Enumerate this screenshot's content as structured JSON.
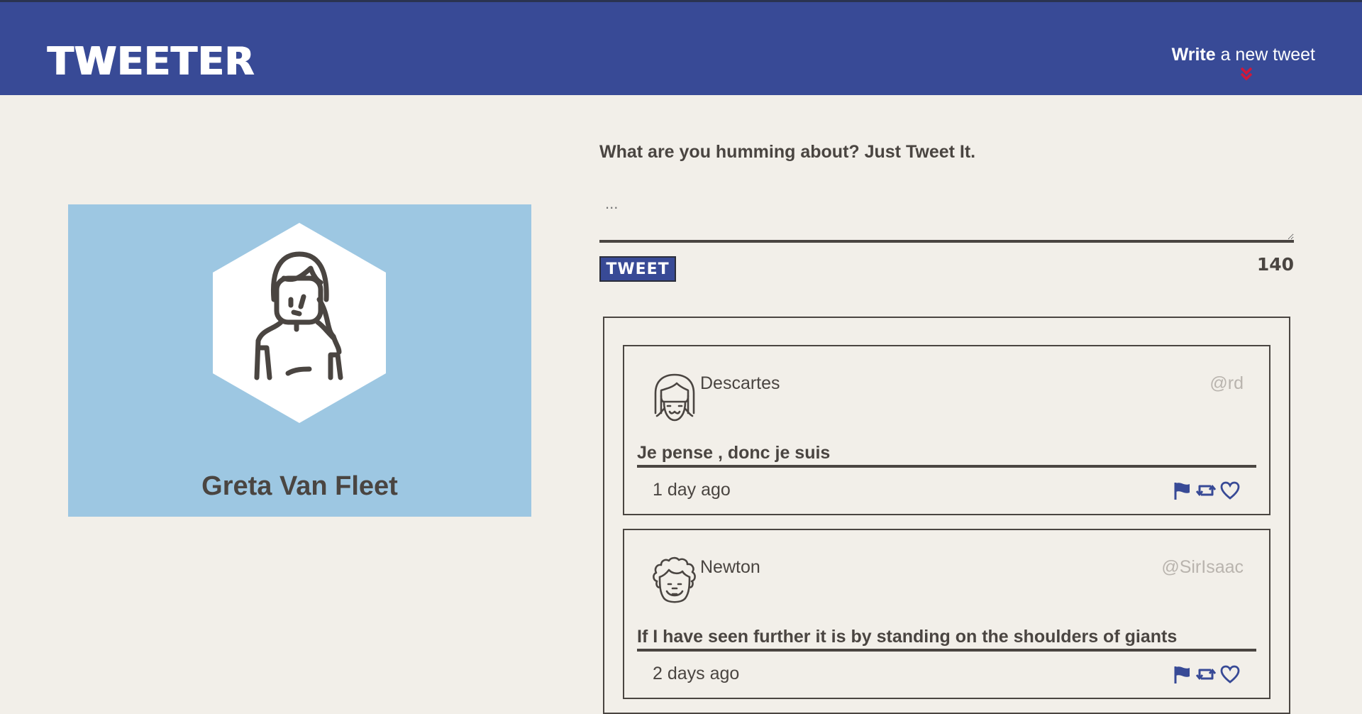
{
  "nav": {
    "brand": "TWEETER",
    "write_bold": "Write",
    "write_rest": " a new tweet",
    "chevron_icon": "double-chevron-down-icon",
    "accent_color": "#d0183a"
  },
  "profile": {
    "name": "Greta Van Fleet",
    "avatar_icon": "woman-avatar-icon",
    "card_color": "#9dc7e2"
  },
  "compose": {
    "prompt": "What are you humming about? Just Tweet It.",
    "placeholder": "...",
    "button_label": "TWEET",
    "counter": "140"
  },
  "tweets": [
    {
      "name": "Descartes",
      "handle": "@rd",
      "text": "Je pense , donc je suis",
      "time": "1 day ago",
      "avatar_icon": "girl-avatar-icon"
    },
    {
      "name": "Newton",
      "handle": "@SirIsaac",
      "text": "If I have seen further it is by standing on the shoulders of giants",
      "time": "2 days ago",
      "avatar_icon": "curly-hair-avatar-icon"
    }
  ],
  "colors": {
    "header": "#384a96",
    "background": "#f2efe9",
    "text": "#4a4541",
    "handle": "#b9b4ae"
  }
}
